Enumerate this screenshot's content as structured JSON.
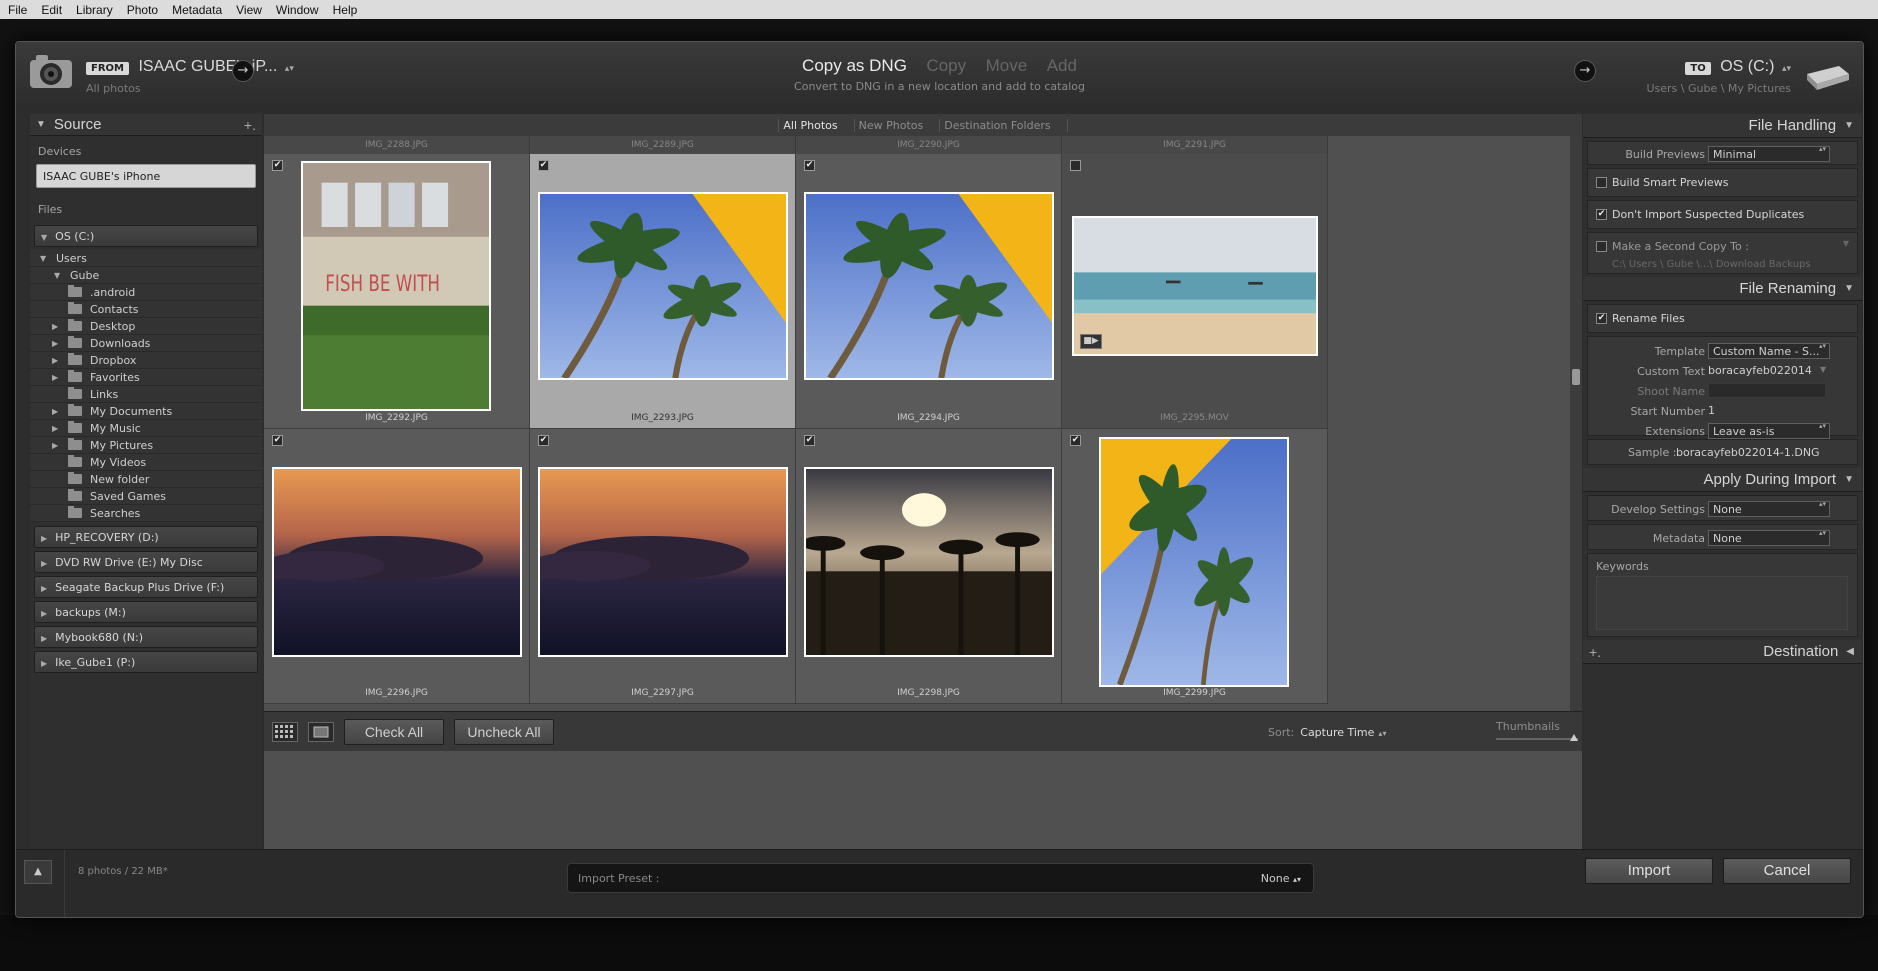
{
  "menu": [
    "File",
    "Edit",
    "Library",
    "Photo",
    "Metadata",
    "View",
    "Window",
    "Help"
  ],
  "header": {
    "from_tag": "FROM",
    "from_name": "ISAAC GUBE's iP...",
    "from_sub": "All photos",
    "modes": [
      "Copy as DNG",
      "Copy",
      "Move",
      "Add"
    ],
    "active_mode": "Copy as DNG",
    "mode_desc": "Convert to DNG in a new location and add to catalog",
    "to_tag": "TO",
    "to_name": "OS (C:)",
    "to_sub": "Users \\ Gube \\ My Pictures"
  },
  "source": {
    "title": "Source",
    "devices_label": "Devices",
    "device": "ISAAC GUBE's iPhone",
    "files_label": "Files",
    "os_volume": "OS (C:)",
    "users": "Users",
    "gube": "Gube",
    "folders": [
      {
        "name": ".android",
        "expandable": false
      },
      {
        "name": "Contacts",
        "expandable": false
      },
      {
        "name": "Desktop",
        "expandable": true
      },
      {
        "name": "Downloads",
        "expandable": true
      },
      {
        "name": "Dropbox",
        "expandable": true
      },
      {
        "name": "Favorites",
        "expandable": true
      },
      {
        "name": "Links",
        "expandable": false
      },
      {
        "name": "My Documents",
        "expandable": true
      },
      {
        "name": "My Music",
        "expandable": true
      },
      {
        "name": "My Pictures",
        "expandable": true
      },
      {
        "name": "My Videos",
        "expandable": false
      },
      {
        "name": "New folder",
        "expandable": false
      },
      {
        "name": "Saved Games",
        "expandable": false
      },
      {
        "name": "Searches",
        "expandable": false
      }
    ],
    "volumes": [
      "HP_RECOVERY (D:)",
      "DVD RW Drive (E:) My Disc",
      "Seagate Backup Plus Drive (F:)",
      "backups (M:)",
      "Mybook680 (N:)",
      "Ike_Gube1 (P:)"
    ]
  },
  "grid": {
    "tabs": [
      "All Photos",
      "New Photos",
      "Destination Folders"
    ],
    "active_tab": "All Photos",
    "top_names": [
      "IMG_2288.JPG",
      "IMG_2289.JPG",
      "IMG_2290.JPG",
      "IMG_2291.JPG"
    ],
    "cells": [
      {
        "name": "IMG_2292.JPG",
        "checked": true,
        "kind": "wall"
      },
      {
        "name": "IMG_2293.JPG",
        "checked": true,
        "kind": "palm",
        "selected": true
      },
      {
        "name": "IMG_2294.JPG",
        "checked": true,
        "kind": "palm"
      },
      {
        "name": "IMG_2295.MOV",
        "checked": false,
        "kind": "beach",
        "video": true
      },
      {
        "name": "IMG_2296.JPG",
        "checked": true,
        "kind": "clouds"
      },
      {
        "name": "IMG_2297.JPG",
        "checked": true,
        "kind": "clouds"
      },
      {
        "name": "IMG_2298.JPG",
        "checked": true,
        "kind": "sunset"
      },
      {
        "name": "IMG_2299.JPG",
        "checked": true,
        "kind": "palm-portrait"
      }
    ],
    "check_all": "Check All",
    "uncheck_all": "Uncheck All",
    "sort_label": "Sort:",
    "sort_value": "Capture Time",
    "thumbnails_label": "Thumbnails"
  },
  "file_handling": {
    "title": "File Handling",
    "build_previews_label": "Build Previews",
    "build_previews_value": "Minimal",
    "smart_previews": "Build Smart Previews",
    "no_duplicates": "Don't Import Suspected Duplicates",
    "second_copy": "Make a Second Copy To :",
    "second_copy_path": "C:\\ Users \\ Gube \\...\\ Download Backups"
  },
  "file_renaming": {
    "title": "File Renaming",
    "rename_files": "Rename Files",
    "template_label": "Template",
    "template_value": "Custom Name - S...",
    "custom_text_label": "Custom Text",
    "custom_text_value": "boracayfeb022014",
    "shoot_name_label": "Shoot Name",
    "start_number_label": "Start Number",
    "start_number_value": "1",
    "extensions_label": "Extensions",
    "extensions_value": "Leave as-is",
    "sample_label": "Sample :",
    "sample_value": "boracayfeb022014-1.DNG"
  },
  "apply": {
    "title": "Apply During Import",
    "develop_label": "Develop Settings",
    "develop_value": "None",
    "metadata_label": "Metadata",
    "metadata_value": "None",
    "keywords_label": "Keywords"
  },
  "destination": {
    "title": "Destination"
  },
  "footer": {
    "count": "8 photos / 22 MB*",
    "preset_label": "Import Preset :",
    "preset_value": "None",
    "import": "Import",
    "cancel": "Cancel"
  }
}
